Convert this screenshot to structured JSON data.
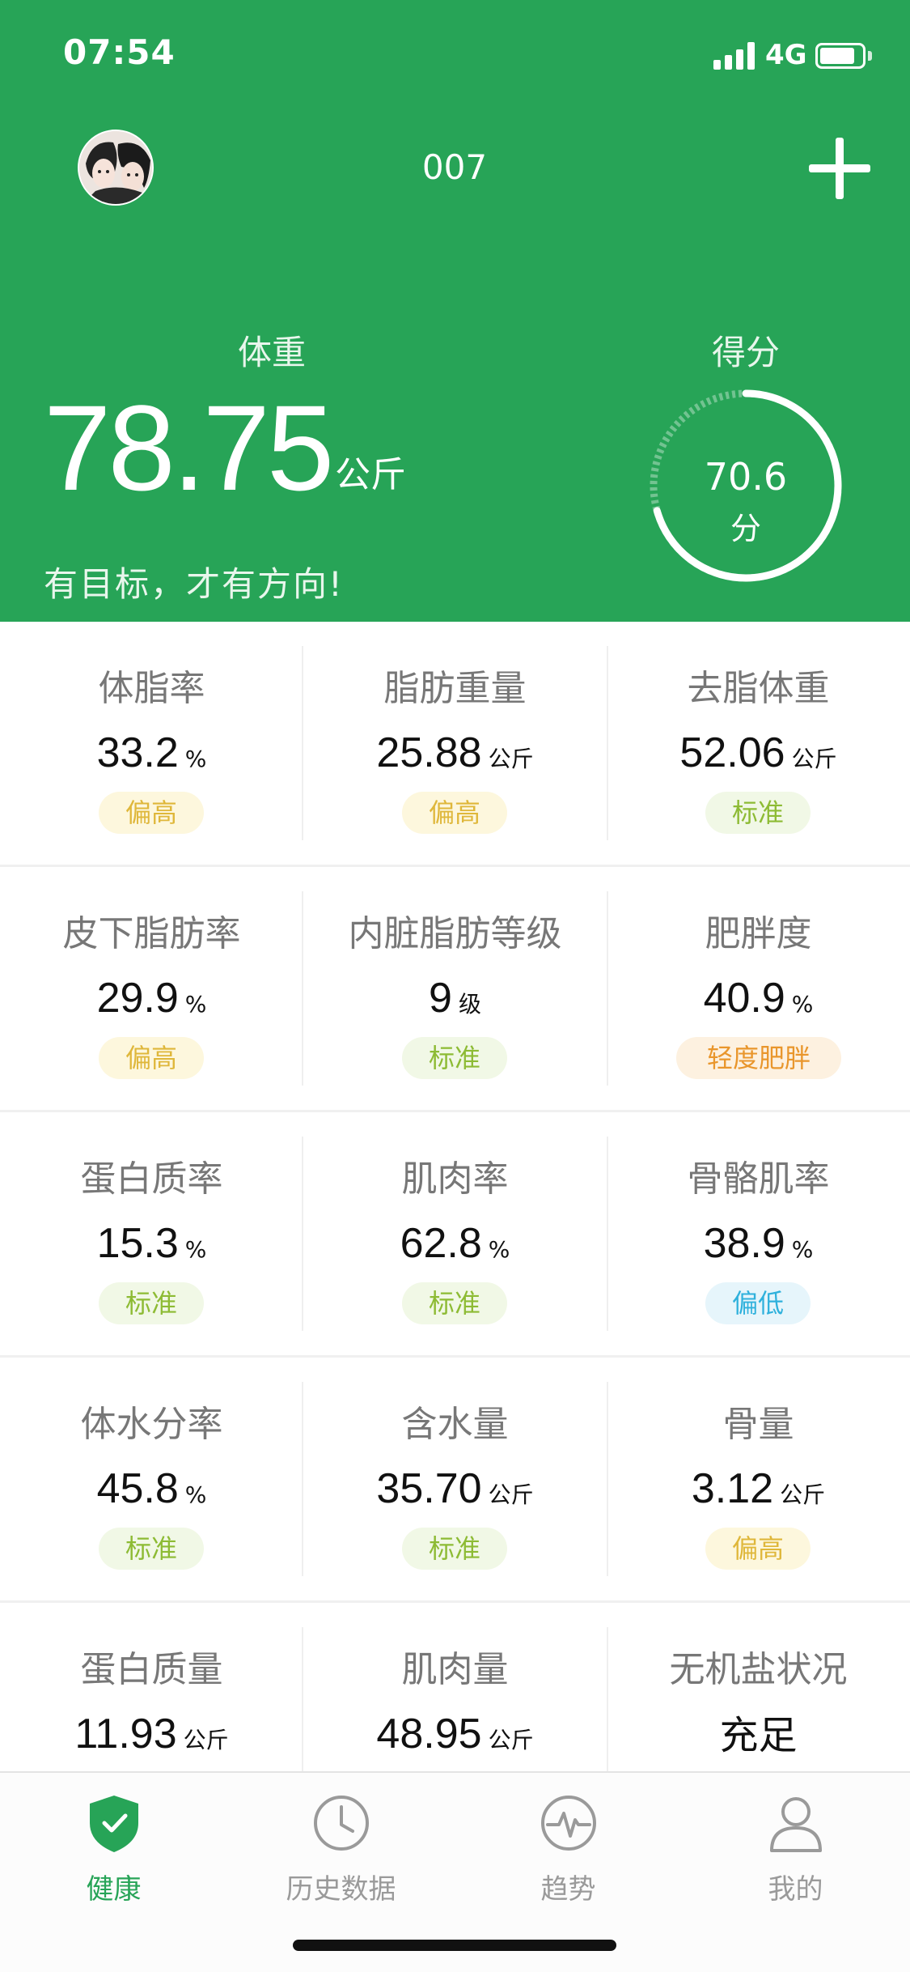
{
  "status_bar": {
    "time": "07:54",
    "network": "4G"
  },
  "header": {
    "user_name": "007",
    "weight_label": "体重",
    "weight_value": "78.75",
    "weight_unit": "公斤",
    "slogan": "有目标，才有方向!",
    "score_label": "得分",
    "score_value": "70.6",
    "score_unit": "分",
    "score_fraction": 0.706,
    "color": "#27a457"
  },
  "metrics": [
    [
      {
        "label": "体脂率",
        "value": "33.2",
        "unit": "%",
        "status": "偏高",
        "level": "high"
      },
      {
        "label": "脂肪重量",
        "value": "25.88",
        "unit": "公斤",
        "status": "偏高",
        "level": "high"
      },
      {
        "label": "去脂体重",
        "value": "52.06",
        "unit": "公斤",
        "status": "标准",
        "level": "std"
      }
    ],
    [
      {
        "label": "皮下脂肪率",
        "value": "29.9",
        "unit": "%",
        "status": "偏高",
        "level": "high"
      },
      {
        "label": "内脏脂肪等级",
        "value": "9",
        "unit": "级",
        "status": "标准",
        "level": "std"
      },
      {
        "label": "肥胖度",
        "value": "40.9",
        "unit": "%",
        "status": "轻度肥胖",
        "level": "obese"
      }
    ],
    [
      {
        "label": "蛋白质率",
        "value": "15.3",
        "unit": "%",
        "status": "标准",
        "level": "std"
      },
      {
        "label": "肌肉率",
        "value": "62.8",
        "unit": "%",
        "status": "标准",
        "level": "std"
      },
      {
        "label": "骨骼肌率",
        "value": "38.9",
        "unit": "%",
        "status": "偏低",
        "level": "low"
      }
    ],
    [
      {
        "label": "体水分率",
        "value": "45.8",
        "unit": "%",
        "status": "标准",
        "level": "std"
      },
      {
        "label": "含水量",
        "value": "35.70",
        "unit": "公斤",
        "status": "标准",
        "level": "std"
      },
      {
        "label": "骨量",
        "value": "3.12",
        "unit": "公斤",
        "status": "偏高",
        "level": "high"
      }
    ],
    [
      {
        "label": "蛋白质量",
        "value": "11.93",
        "unit": "公斤"
      },
      {
        "label": "肌肉量",
        "value": "48.95",
        "unit": "公斤"
      },
      {
        "label": "无机盐状况",
        "plain": "充足"
      }
    ]
  ],
  "status_colors": {
    "high": "#dfb73a",
    "std": "#8dbb34",
    "low": "#2fb1dc",
    "obese": "#e9962c"
  },
  "tabs": [
    {
      "label": "健康",
      "icon": "shield-check-icon",
      "active": true
    },
    {
      "label": "历史数据",
      "icon": "clock-icon",
      "active": false
    },
    {
      "label": "趋势",
      "icon": "pulse-icon",
      "active": false
    },
    {
      "label": "我的",
      "icon": "user-icon",
      "active": false
    }
  ]
}
